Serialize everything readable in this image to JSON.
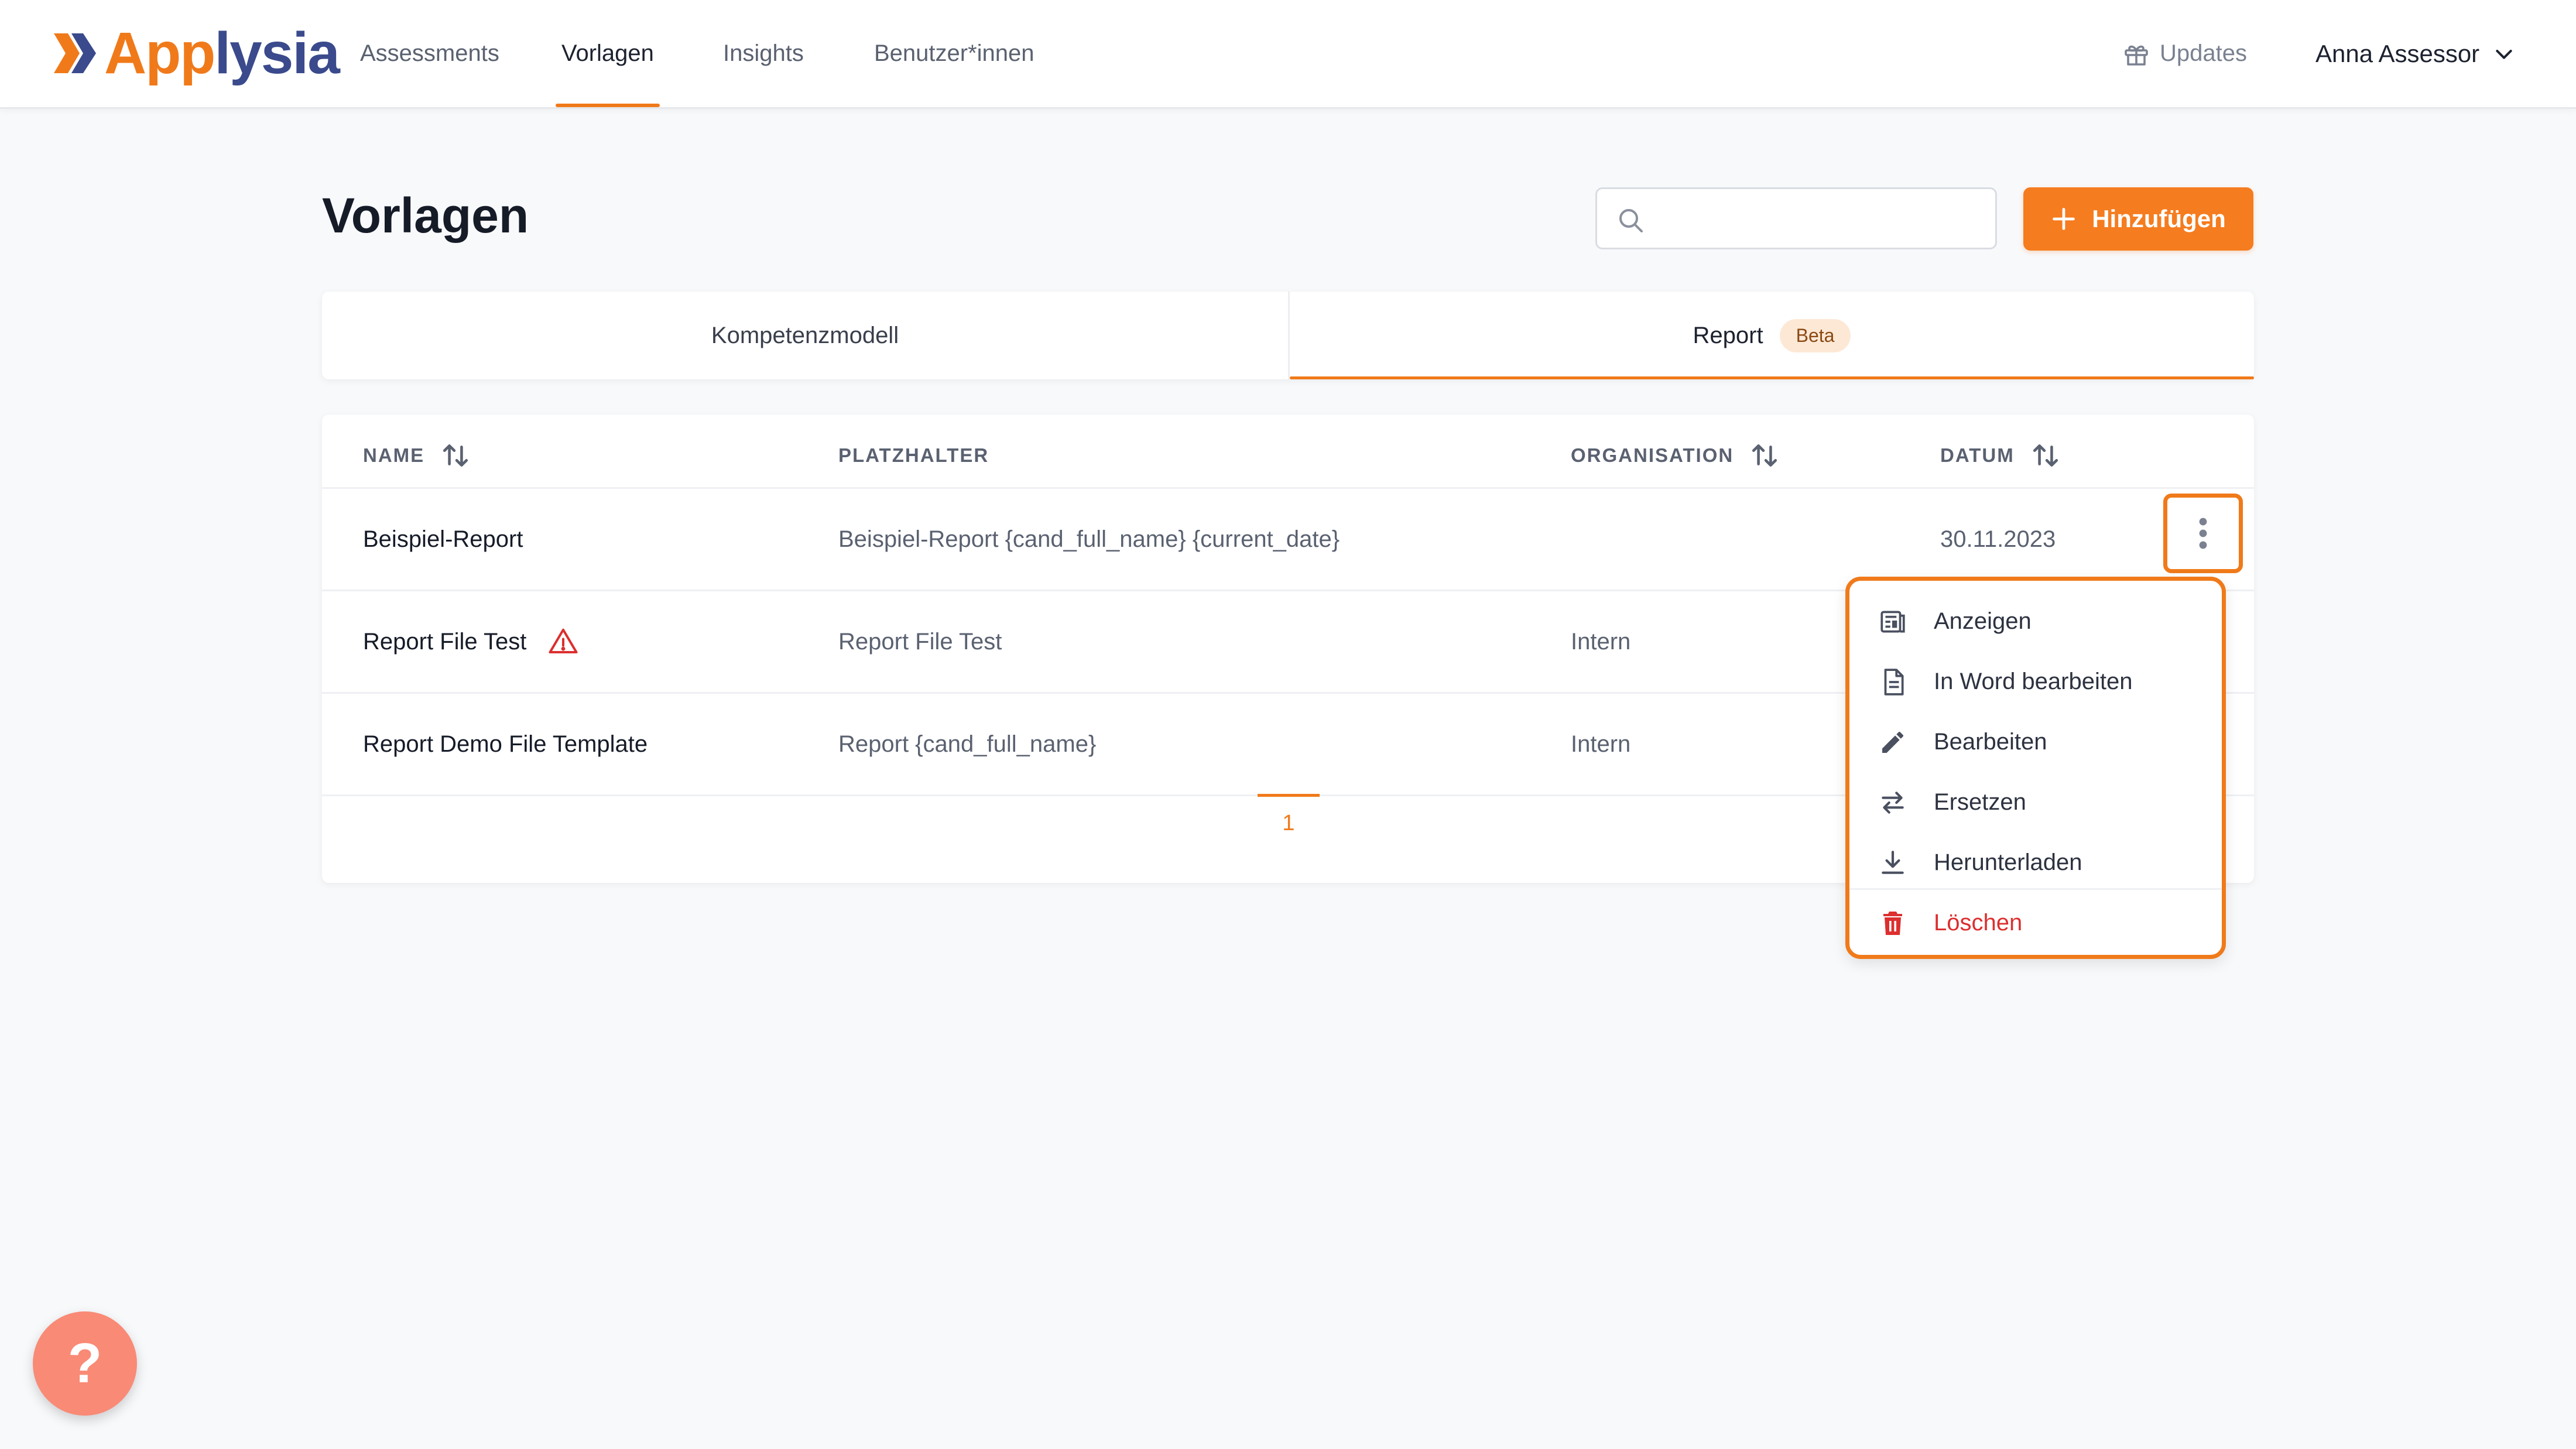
{
  "brand": {
    "part1": "App",
    "part2": "lysia"
  },
  "nav": {
    "items": [
      {
        "label": "Assessments",
        "active": false
      },
      {
        "label": "Vorlagen",
        "active": true
      },
      {
        "label": "Insights",
        "active": false
      },
      {
        "label": "Benutzer*innen",
        "active": false
      }
    ],
    "updates_label": "Updates",
    "user_name": "Anna Assessor"
  },
  "page": {
    "title": "Vorlagen",
    "search_placeholder": "",
    "add_label": "Hinzufügen"
  },
  "tabs": [
    {
      "label": "Kompetenzmodell",
      "active": false
    },
    {
      "label": "Report",
      "badge": "Beta",
      "active": true
    }
  ],
  "table": {
    "columns": [
      {
        "label": "NAME",
        "sortable": true
      },
      {
        "label": "PLATZHALTER",
        "sortable": false
      },
      {
        "label": "ORGANISATION",
        "sortable": true
      },
      {
        "label": "DATUM",
        "sortable": true
      }
    ],
    "rows": [
      {
        "name": "Beispiel-Report",
        "placeholder": "Beispiel-Report {cand_full_name} {current_date}",
        "organisation": "",
        "date": "30.11.2023",
        "warning": false
      },
      {
        "name": "Report File Test",
        "placeholder": "Report File Test",
        "organisation": "Intern",
        "date": "",
        "warning": true
      },
      {
        "name": "Report Demo File Template",
        "placeholder": "Report {cand_full_name}",
        "organisation": "Intern",
        "date": "",
        "warning": false
      }
    ],
    "current_page": "1"
  },
  "row_menu": {
    "items": [
      {
        "label": "Anzeigen",
        "icon": "view-icon"
      },
      {
        "label": "In Word bearbeiten",
        "icon": "document-icon"
      },
      {
        "label": "Bearbeiten",
        "icon": "pencil-icon"
      },
      {
        "label": "Ersetzen",
        "icon": "swap-icon"
      },
      {
        "label": "Herunterladen",
        "icon": "download-icon"
      },
      {
        "label": "Löschen",
        "icon": "trash-icon",
        "danger": true
      }
    ]
  },
  "help": {
    "label": "?"
  },
  "colors": {
    "accent": "#f07a1a",
    "brand_dark": "#3a4a8c",
    "danger": "#dc2f2f",
    "help": "#f98a76"
  }
}
